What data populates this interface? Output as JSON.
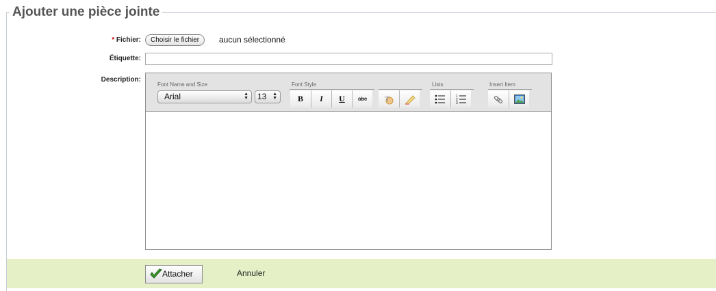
{
  "form": {
    "legend": "Ajouter une pièce jointe",
    "file": {
      "required_mark": "*",
      "label": "Fichier:",
      "button": "Choisir le fichier",
      "status": "aucun sélectionné"
    },
    "tag": {
      "label": "Étiquette:",
      "value": ""
    },
    "description": {
      "label": "Description:"
    }
  },
  "editor": {
    "groups": {
      "font": "Font Name and Size",
      "style": "Font Style",
      "lists": "Lists",
      "insert": "Insert Item"
    },
    "font_name": "Arial",
    "font_size": "13",
    "style_buttons": {
      "bold": "B",
      "italic": "I",
      "underline": "U",
      "strike": "abc"
    },
    "icons": [
      "text-color-icon",
      "highlight-icon",
      "bullet-list-icon",
      "numbered-list-icon",
      "link-icon",
      "image-icon"
    ]
  },
  "actions": {
    "attach": "Attacher",
    "cancel": "Annuler",
    "bar_color": "#e5f0c7"
  }
}
